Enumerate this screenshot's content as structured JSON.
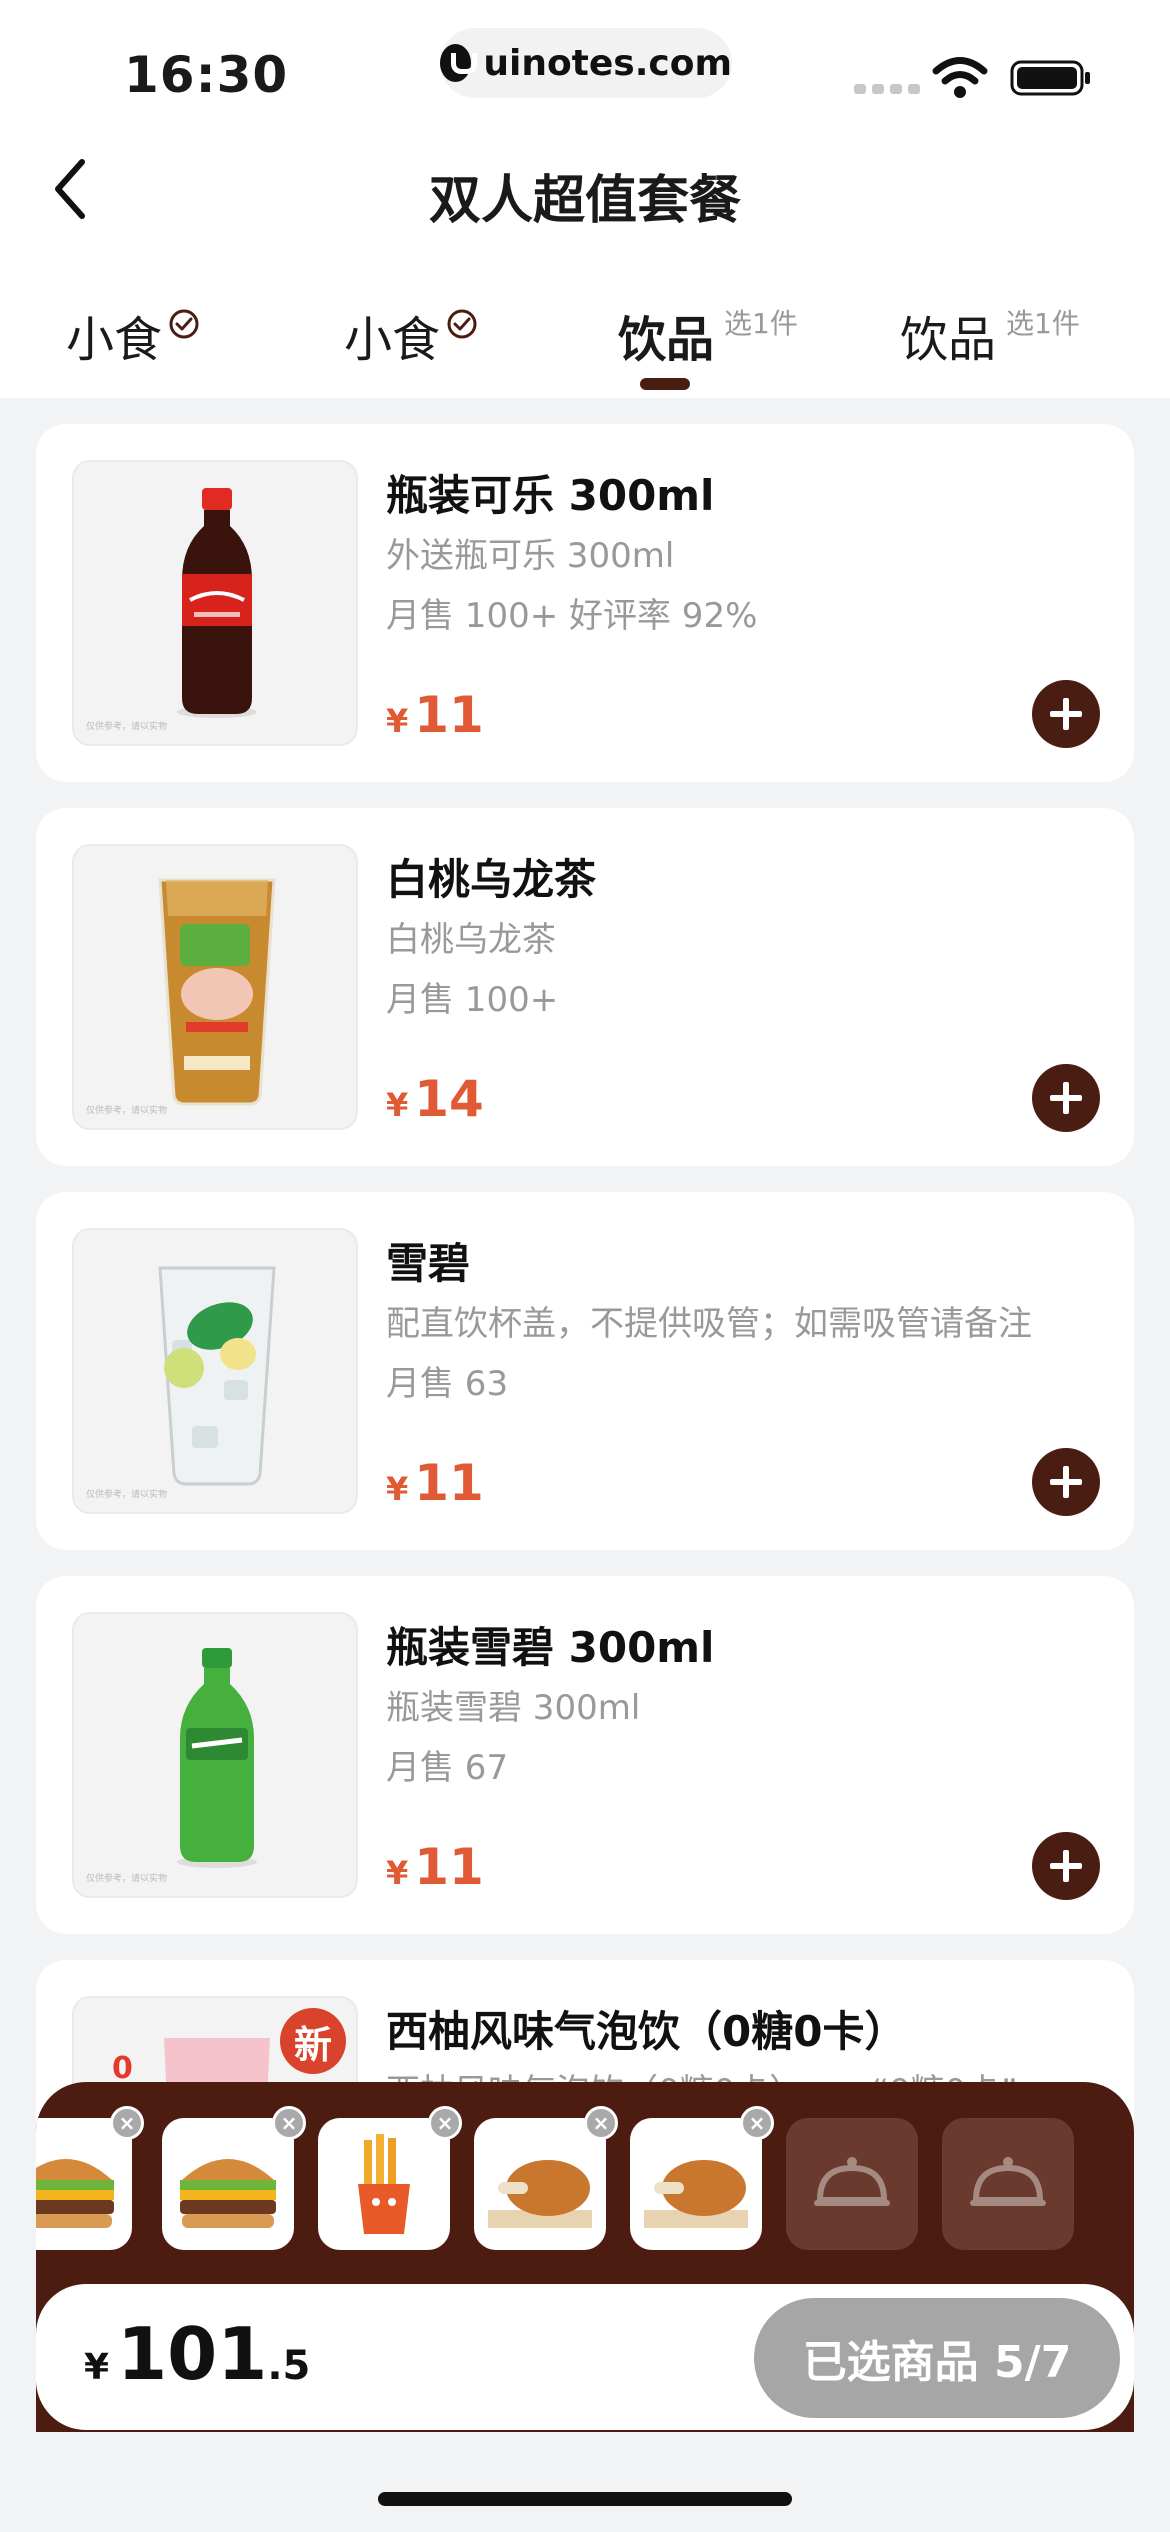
{
  "status_bar": {
    "time": "16:30",
    "url": "uinotes.com"
  },
  "nav": {
    "title": "双人超值套餐"
  },
  "tabs": [
    {
      "label": "小食",
      "hint": "",
      "completed": true,
      "active": false
    },
    {
      "label": "小食",
      "hint": "",
      "completed": true,
      "active": false
    },
    {
      "label": "饮品",
      "hint": "选1件",
      "completed": false,
      "active": true
    },
    {
      "label": "饮品",
      "hint": "选1件",
      "completed": false,
      "active": false
    }
  ],
  "products": [
    {
      "name": "瓶装可乐 300ml",
      "desc": "外送瓶可乐 300ml",
      "meta": "月售 100+  好评率 92%",
      "currency": "¥",
      "price": "11",
      "thumb_note": "仅供参考，请以实物"
    },
    {
      "name": "白桃乌龙茶",
      "desc": "白桃乌龙茶",
      "meta": "月售 100+",
      "currency": "¥",
      "price": "14",
      "thumb_note": "仅供参考，请以实物"
    },
    {
      "name": "雪碧",
      "desc": "配直饮杯盖，不提供吸管；如需吸管请备注",
      "meta": "月售 63",
      "currency": "¥",
      "price": "11",
      "thumb_note": "仅供参考，请以实物"
    },
    {
      "name": "瓶装雪碧 300ml",
      "desc": "瓶装雪碧 300ml",
      "meta": "月售 67",
      "currency": "¥",
      "price": "11",
      "thumb_note": "仅供参考，请以实物"
    },
    {
      "name": "西柚风味气泡饮（0糖0卡）",
      "desc": "西柚风味气泡饮（0糖0卡）……“0糖0卡”",
      "badge": "新"
    }
  ],
  "cart": {
    "items": [
      "burger",
      "burger",
      "fries",
      "chicken-leg",
      "chicken-leg"
    ],
    "empty_slots": 2,
    "currency": "¥",
    "total_int": "101",
    "total_dec": ".5",
    "checkout_label": "已选商品 5/7"
  },
  "colors": {
    "brand": "#4a1d12",
    "price": "#e05a36",
    "checkout_disabled": "#a6a6a6"
  }
}
